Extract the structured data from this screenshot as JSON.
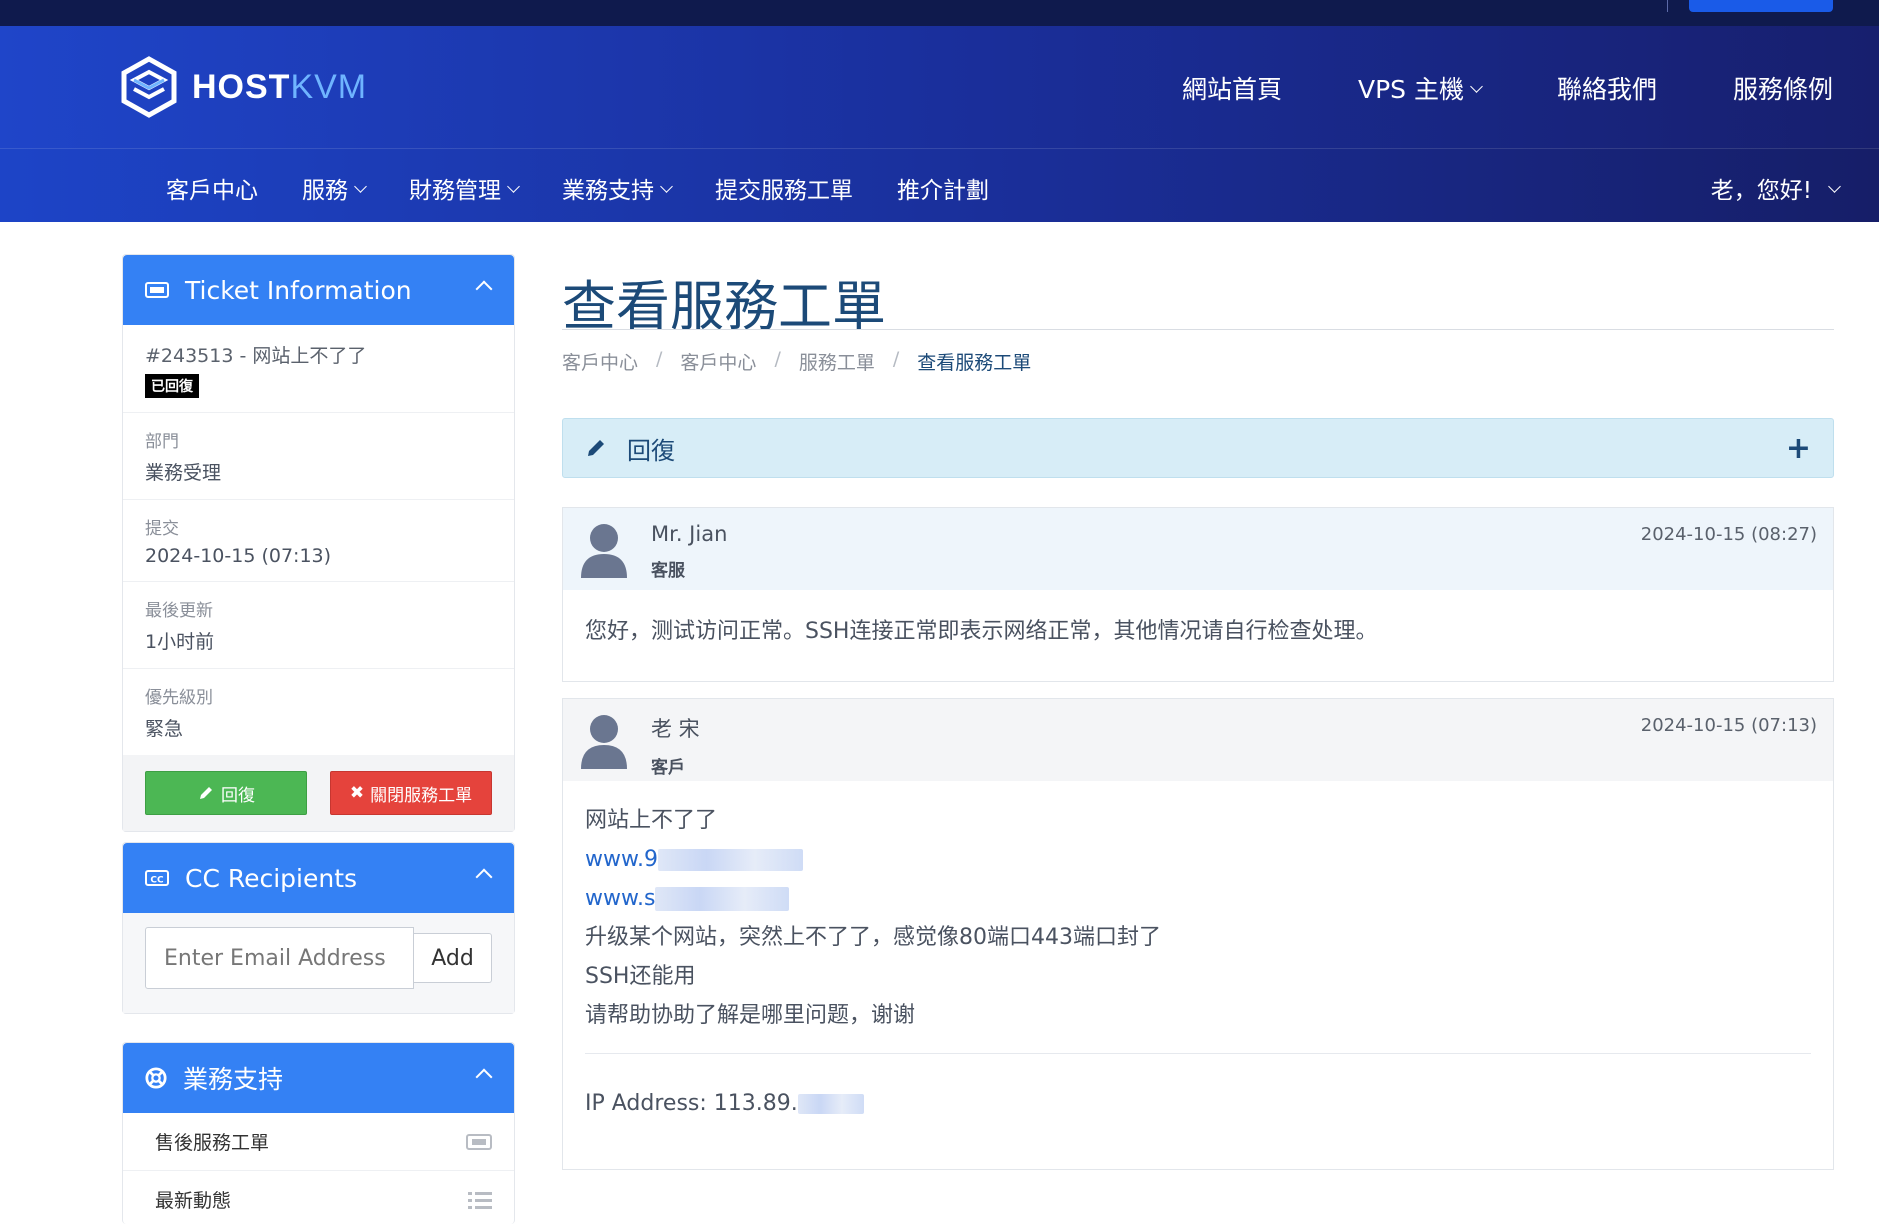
{
  "brand": {
    "host": "HOST",
    "kvm": "KVM"
  },
  "main_nav": [
    {
      "label": "網站首頁"
    },
    {
      "label": "VPS 主機"
    },
    {
      "label": "聯絡我們"
    },
    {
      "label": "服務條例"
    }
  ],
  "sub_nav": [
    {
      "label": "客戶中心"
    },
    {
      "label": "服務"
    },
    {
      "label": "財務管理"
    },
    {
      "label": "業務支持"
    },
    {
      "label": "提交服務工單"
    },
    {
      "label": "推介計劃"
    }
  ],
  "user_greeting": "老，您好!",
  "ticket_panel": {
    "title": "Ticket Information",
    "ticket_ref": "#243513 - 网站上不了了",
    "status": "已回復",
    "fields": [
      {
        "label": "部門",
        "value": "業務受理"
      },
      {
        "label": "提交",
        "value": "2024-10-15 (07:13)"
      },
      {
        "label": "最後更新",
        "value": "1小时前"
      },
      {
        "label": "優先級別",
        "value": "緊急"
      }
    ],
    "reply_button": "回復",
    "close_button": "關閉服務工單"
  },
  "cc_panel": {
    "title": "CC Recipients",
    "email_placeholder": "Enter Email Address",
    "add_button": "Add"
  },
  "support_panel": {
    "title": "業務支持",
    "links": [
      {
        "label": "售後服務工單",
        "icon": "ticket-icon"
      },
      {
        "label": "最新動態",
        "icon": "list-icon"
      }
    ]
  },
  "page": {
    "title": "查看服務工單",
    "breadcrumb": [
      "客戶中心",
      "客戶中心",
      "服務工單",
      "查看服務工單"
    ]
  },
  "reply_bar": {
    "label": "回復",
    "toggle": "+"
  },
  "messages": [
    {
      "name": "Mr. Jian",
      "role": "客服",
      "date": "2024-10-15 (08:27)",
      "lines": [
        "您好，测试访问正常。SSH连接正常即表示网络正常，其他情况请自行检查处理。"
      ]
    },
    {
      "name": "老 宋",
      "role": "客戶",
      "date": "2024-10-15 (07:13)",
      "line1": "网站上不了了",
      "link1": "www.9",
      "link2": "www.s",
      "line4": "升级某个网站，突然上不了了，感觉像80端口443端口封了",
      "line5": "SSH还能用",
      "line6": "请帮助协助了解是哪里问题，谢谢",
      "ip": "IP Address: 113.89."
    }
  ],
  "colors": {
    "accent": "#3481f4",
    "header": "#1a2f9c",
    "title": "#1c4a78",
    "green": "#4cb754",
    "red": "#e5433c"
  }
}
